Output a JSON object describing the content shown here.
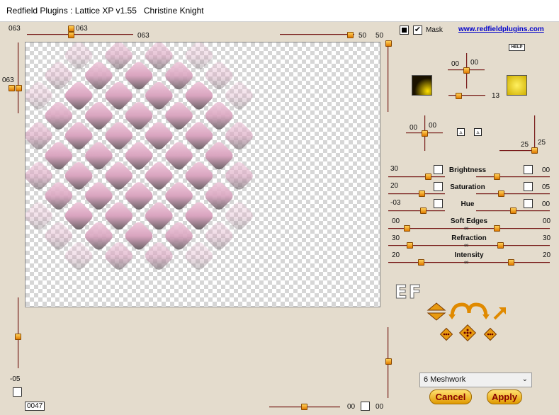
{
  "window": {
    "title": "Redfield Plugins : Lattice XP v1.55   Christine Knight"
  },
  "top": {
    "left_val_a": "063",
    "slider_top_val": "063",
    "slider_mid_val": "063",
    "slider_right_val_a": "50",
    "slider_right_val_b": "50",
    "left_vertical_val": "063"
  },
  "right_header": {
    "mask_label": "Mask",
    "mask_checked": true,
    "website": "www.redfieldplugins.com",
    "help_label": "HELP"
  },
  "light": {
    "x_val": "00",
    "y_val": "00",
    "size_val": "13",
    "swatch_left_color": "#1a1200",
    "swatch_right_color": "#f0d010"
  },
  "bevel": {
    "x_val": "00",
    "y_val": "00",
    "depth_label_a": "25",
    "depth_label_b": "25",
    "tri_a": "▵",
    "tri_b": "▵"
  },
  "adjust_rows": [
    {
      "left": "30",
      "label": "Brightness",
      "right": "00"
    },
    {
      "left": "20",
      "label": "Saturation",
      "right": "05"
    },
    {
      "left": "-03",
      "label": "Hue",
      "right": "00"
    }
  ],
  "linked_rows": [
    {
      "left": "00",
      "label": "Soft Edges",
      "right": "00"
    },
    {
      "left": "30",
      "label": "Refraction",
      "right": "30"
    },
    {
      "left": "20",
      "label": "Intensity",
      "right": "20"
    }
  ],
  "ef_logo": "EF",
  "pattern": {
    "selected": "6 Meshwork"
  },
  "buttons": {
    "cancel": "Cancel",
    "apply": "Apply"
  },
  "bottom": {
    "left_vertical_val": "-05",
    "counter": "0047",
    "slider_val": "00",
    "right_val": "00"
  }
}
